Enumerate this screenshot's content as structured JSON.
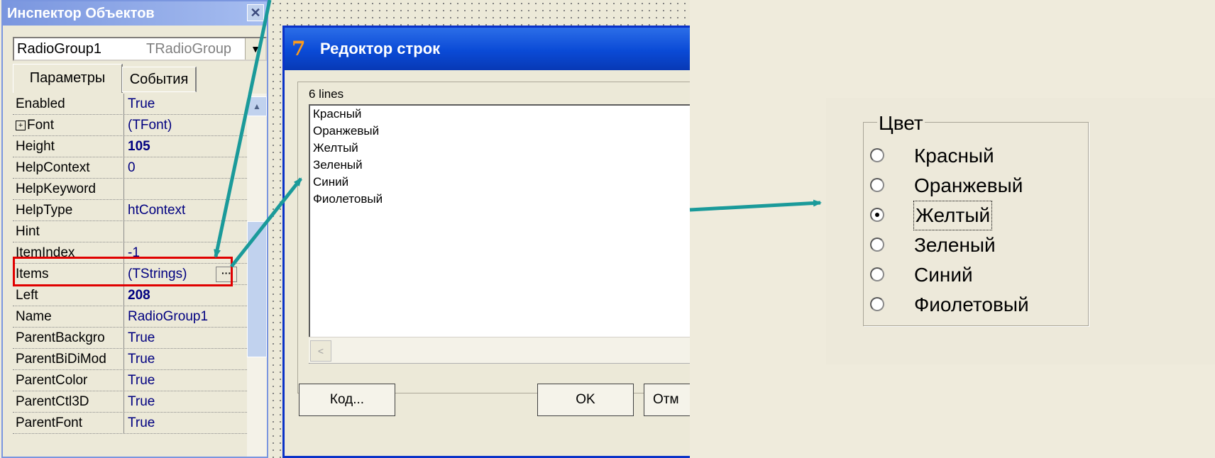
{
  "inspector": {
    "title": "Инспектор Объектов",
    "close_glyph": "✕",
    "component_name": "RadioGroup1",
    "component_type": "TRadioGroup",
    "combo_arrow": "▼",
    "tabs": [
      "Параметры",
      "События"
    ],
    "scroll_up_glyph": "▲",
    "properties": [
      {
        "name": "Enabled",
        "value": "True"
      },
      {
        "name": "Font",
        "value": "(TFont)",
        "expandable": true
      },
      {
        "name": "Height",
        "value": "105",
        "bold": true
      },
      {
        "name": "HelpContext",
        "value": "0"
      },
      {
        "name": "HelpKeyword",
        "value": ""
      },
      {
        "name": "HelpType",
        "value": "htContext"
      },
      {
        "name": "Hint",
        "value": ""
      },
      {
        "name": "ItemIndex",
        "value": "-1"
      },
      {
        "name": "Items",
        "value": "(TStrings)",
        "button": "···"
      },
      {
        "name": "Left",
        "value": "208",
        "bold": true
      },
      {
        "name": "Name",
        "value": "RadioGroup1"
      },
      {
        "name": "ParentBackgro",
        "value": "True"
      },
      {
        "name": "ParentBiDiMod",
        "value": "True"
      },
      {
        "name": "ParentColor",
        "value": "True"
      },
      {
        "name": "ParentCtl3D",
        "value": "True"
      },
      {
        "name": "ParentFont",
        "value": "True"
      }
    ]
  },
  "string_editor": {
    "title": "Редоктор строк",
    "icon_glyph": "7",
    "line_count": "6 lines",
    "lines": [
      "Красный",
      "Оранжевый",
      "Желтый",
      "Зеленый",
      "Синий",
      "Фиолетовый"
    ],
    "scroll_left_glyph": "<",
    "buttons": {
      "code": "Код...",
      "ok": "OK",
      "cancel": "Отм"
    }
  },
  "radio_group": {
    "caption": "Цвет",
    "items": [
      "Красный",
      "Оранжевый",
      "Желтый",
      "Зеленый",
      "Синий",
      "Фиолетовый"
    ],
    "selected_index": 2
  },
  "colors": {
    "arrow": "#1a9a9a",
    "highlight": "#e00000",
    "title_bar": "#0a4ad6"
  }
}
